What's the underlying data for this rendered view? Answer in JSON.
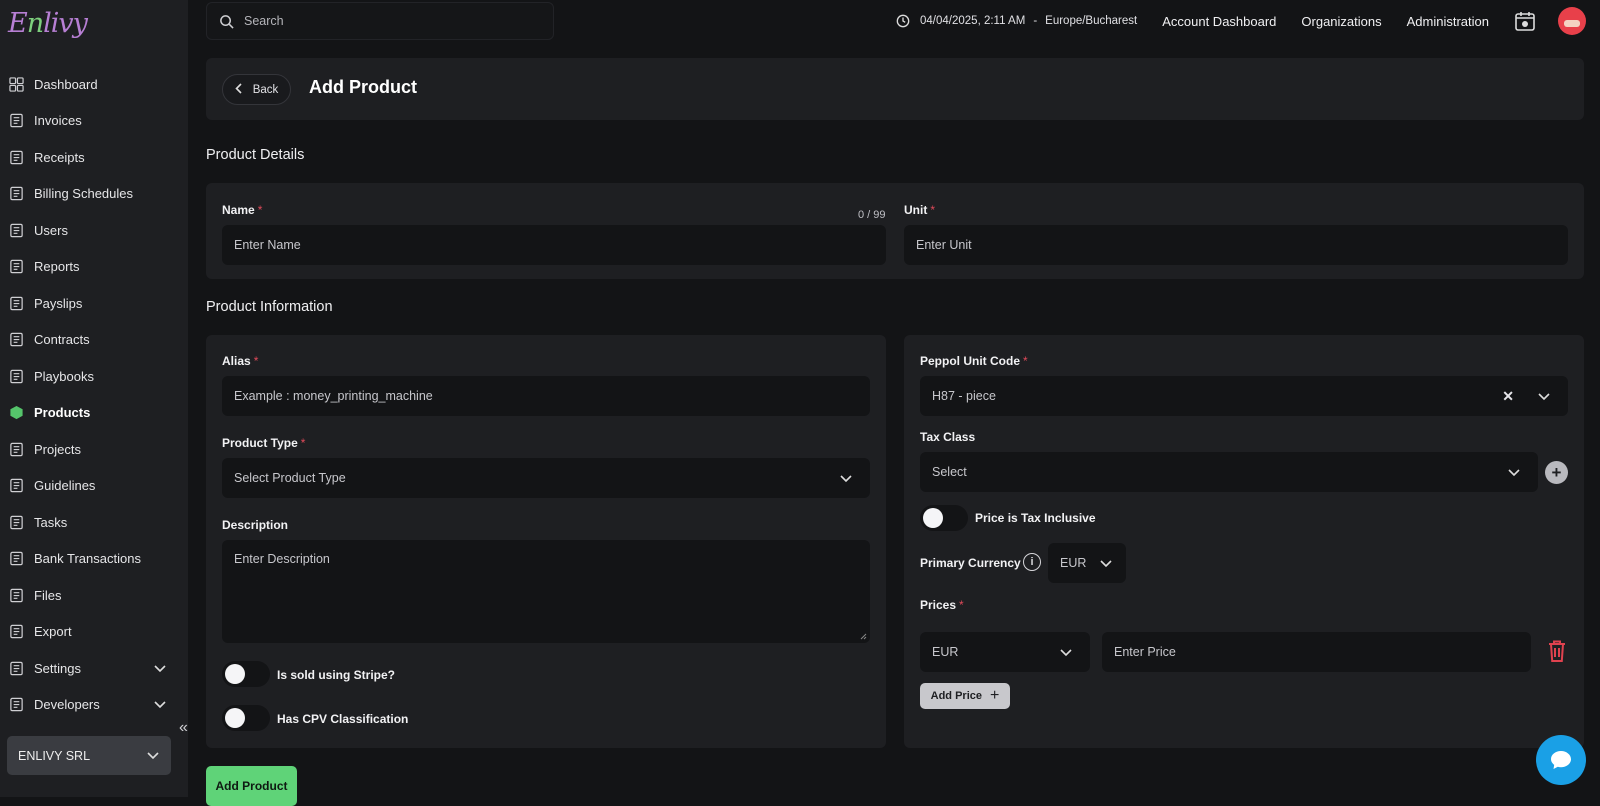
{
  "brand": {
    "logo_text": "Enlivy"
  },
  "sidebar": {
    "items": [
      {
        "label": "Dashboard",
        "icon": "dashboard-icon"
      },
      {
        "label": "Invoices",
        "icon": "invoice-icon"
      },
      {
        "label": "Receipts",
        "icon": "receipt-icon"
      },
      {
        "label": "Billing Schedules",
        "icon": "billing-schedule-icon"
      },
      {
        "label": "Users",
        "icon": "users-icon"
      },
      {
        "label": "Reports",
        "icon": "reports-icon"
      },
      {
        "label": "Payslips",
        "icon": "payslip-icon"
      },
      {
        "label": "Contracts",
        "icon": "contract-icon"
      },
      {
        "label": "Playbooks",
        "icon": "playbook-icon"
      },
      {
        "label": "Products",
        "icon": "product-box-icon",
        "active": true
      },
      {
        "label": "Projects",
        "icon": "projects-icon"
      },
      {
        "label": "Guidelines",
        "icon": "guidelines-icon"
      },
      {
        "label": "Tasks",
        "icon": "tasks-icon"
      },
      {
        "label": "Bank Transactions",
        "icon": "bank-icon"
      },
      {
        "label": "Files",
        "icon": "file-icon"
      },
      {
        "label": "Export",
        "icon": "export-icon"
      },
      {
        "label": "Settings",
        "icon": "settings-icon"
      },
      {
        "label": "Developers",
        "icon": "developers-icon"
      }
    ],
    "org_name": "ENLIVY SRL"
  },
  "topbar": {
    "search_placeholder": "Search",
    "datetime": "04/04/2025, 2:11 AM",
    "timezone": "Europe/Bucharest",
    "separator": "-",
    "links": [
      "Account Dashboard",
      "Organizations",
      "Administration"
    ]
  },
  "header": {
    "back_label": "Back",
    "title": "Add Product"
  },
  "product_details": {
    "section_title": "Product Details",
    "name_label": "Name",
    "name_placeholder": "Enter Name",
    "name_counter": "0 / 99",
    "unit_label": "Unit",
    "unit_placeholder": "Enter Unit"
  },
  "product_information": {
    "section_title": "Product Information",
    "alias_label": "Alias",
    "alias_placeholder": "Example : money_printing_machine",
    "product_type_label": "Product Type",
    "product_type_placeholder": "Select Product Type",
    "description_label": "Description",
    "description_placeholder": "Enter Description",
    "stripe_label": "Is sold using Stripe?",
    "cpv_label": "Has CPV Classification",
    "peppol_label": "Peppol Unit Code",
    "peppol_value": "H87 - piece",
    "tax_class_label": "Tax Class",
    "tax_class_value": "Select",
    "tax_inclusive_label": "Price is Tax Inclusive",
    "primary_currency_label": "Primary Currency",
    "primary_currency_value": "EUR",
    "prices_label": "Prices",
    "price_currency": "EUR",
    "price_placeholder": "Enter Price",
    "add_price_label": "Add Price"
  },
  "submit_label": "Add Product",
  "colors": {
    "accent": "#5fd378",
    "danger": "#e0424f",
    "chat": "#1aa0e6"
  }
}
